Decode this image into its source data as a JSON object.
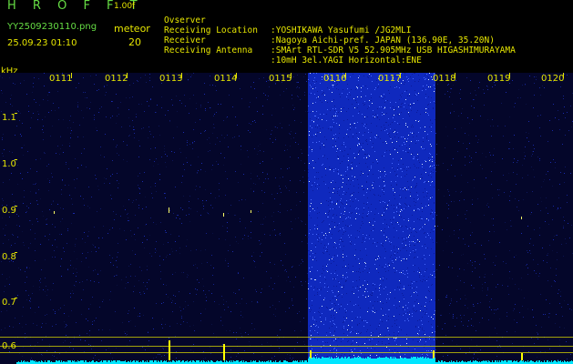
{
  "header": {
    "logo": "H R O F F T",
    "version": "1.00f",
    "filename": "YY2509230110.png",
    "meteor_label": "meteor",
    "datetime": "25.09.23 01:10",
    "meteor_count": "20"
  },
  "info": [
    {
      "key": "Ovserver",
      "value": ":YOSHIKAWA Yasufumi /JG2MLI"
    },
    {
      "key": "Receiving Location",
      "value": ":Nagoya Aichi-pref. JAPAN (136.90E, 35.20N)"
    },
    {
      "key": "Receiver",
      "value": ":SMArt RTL-SDR V5 52.905MHz USB HIGASHIMURAYAMA"
    },
    {
      "key": "Receiving Antenna",
      "value": ":10mH 3el.YAGI Horizontal:ENE"
    }
  ],
  "spectrogram": {
    "y_unit": "kHz",
    "time_ticks": [
      "0111",
      "0112",
      "0113",
      "0114",
      "0115",
      "0116",
      "0117",
      "0118",
      "0119",
      "0120"
    ],
    "freq_ticks": [
      "1.1",
      "1.0",
      "0.9",
      "0.8",
      "0.7",
      "0.6"
    ],
    "colors": {
      "text": "#e6e600",
      "green_text": "#66dd44",
      "noise_dark": "#060a3a",
      "burst_band": "#1a3aff",
      "meteor_echo": "#ffff00",
      "baseline": "#00e5ff"
    }
  }
}
